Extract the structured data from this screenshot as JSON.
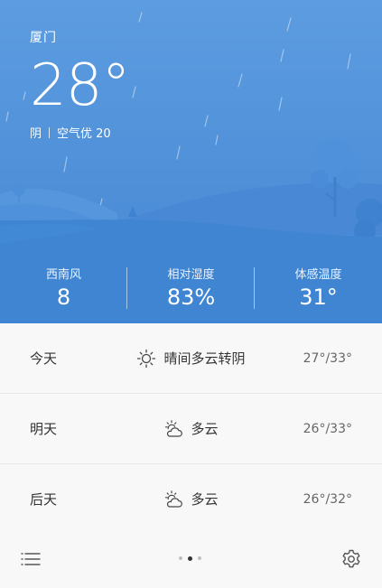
{
  "current": {
    "city": "厦门",
    "temperature": "28°",
    "condition": "阴",
    "air_quality": "空气优 20"
  },
  "stats": [
    {
      "label": "西南风",
      "value": "8"
    },
    {
      "label": "相对湿度",
      "value": "83%"
    },
    {
      "label": "体感温度",
      "value": "31°"
    }
  ],
  "forecast": [
    {
      "day": "今天",
      "icon": "sunny-icon",
      "weather": "晴间多云转阴",
      "range": "27°/33°"
    },
    {
      "day": "明天",
      "icon": "partly-cloudy-icon",
      "weather": "多云",
      "range": "26°/33°"
    },
    {
      "day": "后天",
      "icon": "partly-cloudy-icon",
      "weather": "多云",
      "range": "26°/32°"
    }
  ],
  "pager": {
    "pages": 3,
    "active_page": 2
  },
  "icons": {
    "menu": "list-menu-icon",
    "settings": "gear-icon"
  },
  "colors": {
    "sky": "#5d9ce0",
    "hill_front": "#3f85d2",
    "text_dark": "#333333",
    "text_muted": "#666666"
  }
}
